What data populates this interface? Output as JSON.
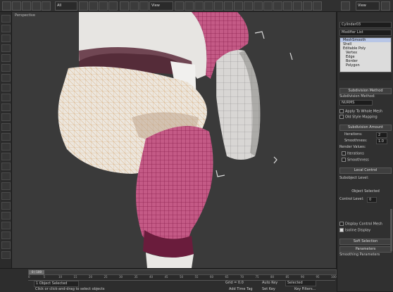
{
  "toolbar": {
    "filter_select": "All",
    "view_select": "View",
    "named_select": "View"
  },
  "viewport": {
    "label": "Perspective"
  },
  "command_panel": {
    "object_name": "Cylinder03",
    "modifier_list": "Modifier List",
    "stack": [
      "MeshSmooth",
      "Shell",
      "Editable Poly",
      "Vertex",
      "Edge",
      "Border",
      "Polygon"
    ],
    "subdivision_method": {
      "header": "Subdivision Method",
      "label": "Subdivision Method:",
      "value": "NURMS",
      "apply_whole_mesh": "Apply To Whole Mesh",
      "old_style_mapping": "Old Style Mapping"
    },
    "subdivision_amount": {
      "header": "Subdivision Amount",
      "iterations_label": "Iterations:",
      "iterations_value": "2",
      "smoothness_label": "Smoothness:",
      "smoothness_value": "1.0",
      "render_values": "Render Values:",
      "r_iterations_label": "Iterations",
      "r_smoothness_label": "Smoothness"
    },
    "local_control": {
      "header": "Local Control",
      "subobject_level": "Subobject Level:",
      "object_selected": "Object Selected",
      "control_level_label": "Control Level:",
      "control_level_value": "0",
      "display_control_mesh": "Display Control Mesh",
      "isoline_display": "Isoline Display"
    },
    "soft_selection": {
      "header": "Soft Selection"
    },
    "parameters": {
      "header": "Parameters",
      "smoothing_params": "Smoothing Parameters"
    }
  },
  "timeline": {
    "frame": "0 / 100",
    "ticks": [
      "0",
      "5",
      "10",
      "15",
      "20",
      "25",
      "30",
      "35",
      "40",
      "45",
      "50",
      "55",
      "60",
      "65",
      "70",
      "75",
      "80",
      "85",
      "90",
      "95",
      "100"
    ]
  },
  "status_bar": {
    "selection": "1 Object Selected",
    "prompt": "Click or click-and-drag to select objects",
    "grid": "Grid = 0.0",
    "autokey": "Auto Key",
    "selected": "Selected",
    "set_key": "Set Key",
    "key_filters": "Key Filters...",
    "add_time_tag": "Add Time Tag"
  },
  "colors": {
    "background": "#3a3a3a",
    "mesh_pink": "#c0356f",
    "mesh_white": "#e9e7e3",
    "selection_bracket": "#dcdcdc"
  }
}
